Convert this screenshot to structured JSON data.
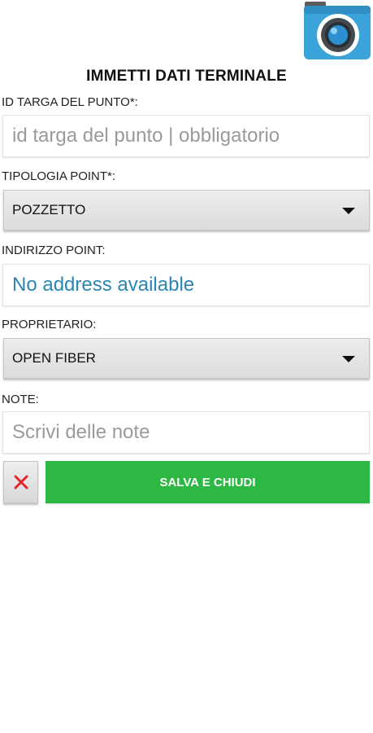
{
  "header": {
    "camera_icon": "camera-icon",
    "title": "IMMETTI DATI TERMINALE"
  },
  "form": {
    "id_targa": {
      "label": "ID TARGA DEL PUNTO*:",
      "placeholder": "id targa del punto | obbligatorio"
    },
    "tipologia": {
      "label": "TIPOLOGIA POINT*:",
      "selected": "POZZETTO"
    },
    "indirizzo": {
      "label": "INDIRIZZO POINT:",
      "value": "No address available"
    },
    "proprietario": {
      "label": "PROPRIETARIO:",
      "selected": "OPEN FIBER"
    },
    "note": {
      "label": "NOTE:",
      "placeholder": "Scrivi delle note"
    }
  },
  "actions": {
    "cancel_icon": "close-icon",
    "save_label": "SALVA E CHIUDI"
  },
  "colors": {
    "save_button": "#2cb842",
    "cancel_x": "#e8212b",
    "address_text": "#2a86b4",
    "camera_bg": "#3aa3d9"
  }
}
